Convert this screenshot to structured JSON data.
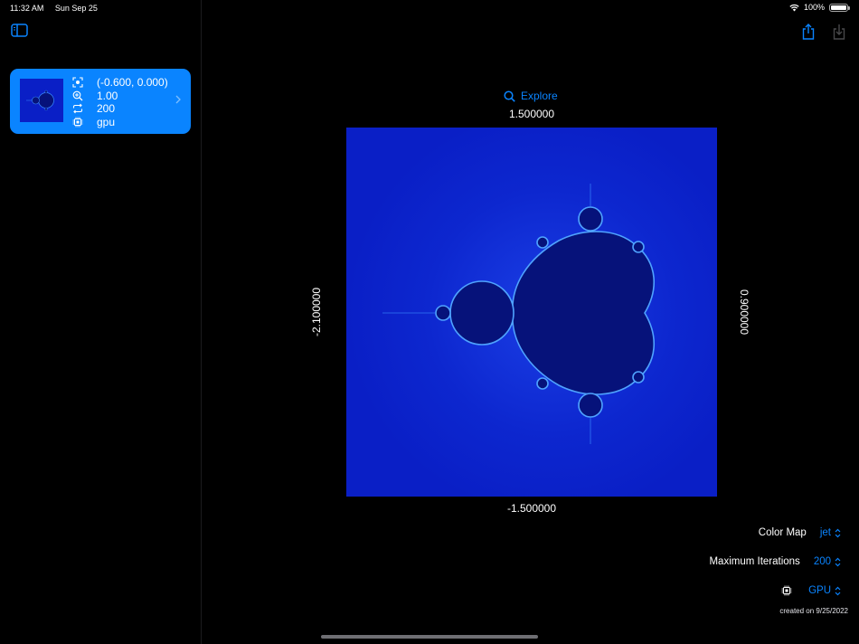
{
  "status": {
    "time": "11:32 AM",
    "date": "Sun Sep 25",
    "battery": "100%",
    "battery_level": 1.0
  },
  "sidebar": {
    "items": [
      {
        "center": "(-0.600, 0.000)",
        "zoom": "1.00",
        "iterations": "200",
        "device": "gpu"
      }
    ]
  },
  "main": {
    "explore_label": "Explore",
    "axis": {
      "top": "1.500000",
      "bottom": "-1.500000",
      "left": "-2.100000",
      "right": "0.900000"
    },
    "controls": {
      "color_map_label": "Color Map",
      "color_map_value": "jet",
      "max_iter_label": "Maximum Iterations",
      "max_iter_value": "200",
      "device_value": "GPU"
    },
    "created": "created on 9/25/2022"
  },
  "colors": {
    "accent": "#0a84ff",
    "background": "#000000",
    "fractal_bg": "#0a1fc6",
    "fractal_set": "#06127a"
  },
  "icons": [
    "sidebar-toggle-icon",
    "share-icon",
    "download-icon",
    "search-icon",
    "crosshair-icon",
    "magnify-icon",
    "repeat-icon",
    "chip-icon",
    "chevron-right-icon",
    "updown-chevron-icon",
    "wifi-icon",
    "battery-icon"
  ]
}
